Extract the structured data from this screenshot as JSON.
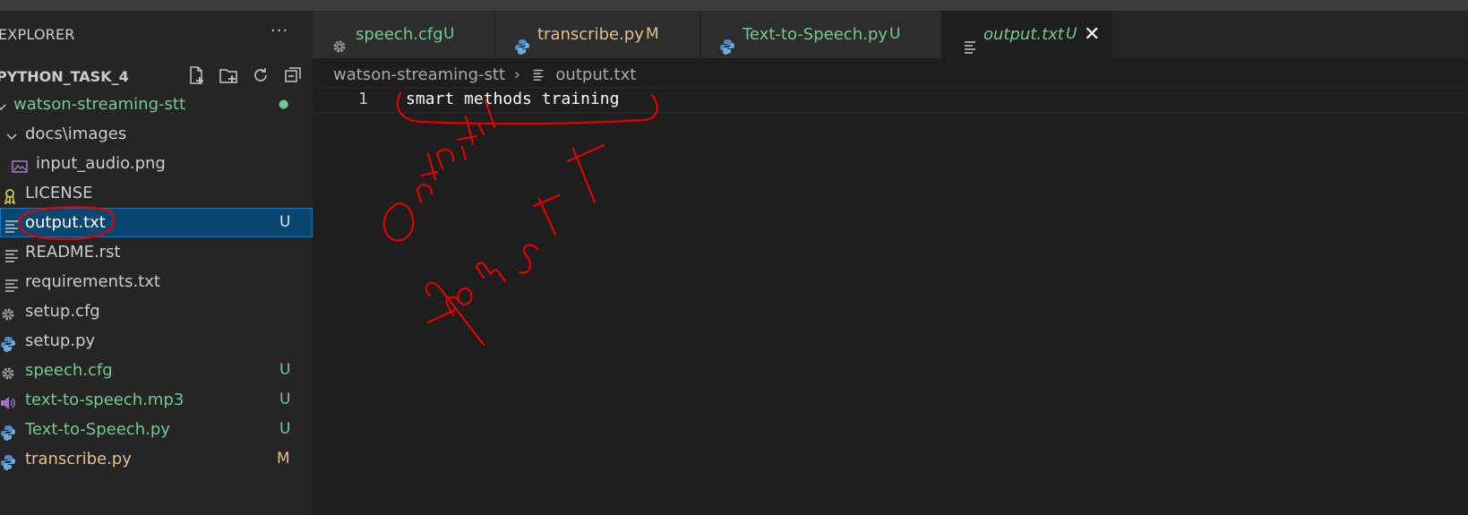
{
  "sidebar": {
    "title": "EXPLORER",
    "more_label": "···",
    "project": "PYTHON_TASK_4",
    "items": [
      {
        "label": "watson-streaming-stt",
        "badge": "●",
        "icon": "chevron-down-icon"
      },
      {
        "label": "docs\\images",
        "badge": "",
        "icon": "chevron-down-icon"
      },
      {
        "label": "input_audio.png",
        "badge": "",
        "icon": "image-icon"
      },
      {
        "label": "LICENSE",
        "badge": "",
        "icon": "license-icon"
      },
      {
        "label": "output.txt",
        "badge": "U",
        "icon": "text-file-icon"
      },
      {
        "label": "README.rst",
        "badge": "",
        "icon": "text-file-icon"
      },
      {
        "label": "requirements.txt",
        "badge": "",
        "icon": "text-file-icon"
      },
      {
        "label": "setup.cfg",
        "badge": "",
        "icon": "gear-icon"
      },
      {
        "label": "setup.py",
        "badge": "",
        "icon": "python-icon"
      },
      {
        "label": "speech.cfg",
        "badge": "U",
        "icon": "gear-icon"
      },
      {
        "label": "text-to-speech.mp3",
        "badge": "U",
        "icon": "audio-icon"
      },
      {
        "label": "Text-to-Speech.py",
        "badge": "U",
        "icon": "python-icon"
      },
      {
        "label": "transcribe.py",
        "badge": "M",
        "icon": "python-icon"
      }
    ]
  },
  "tabs": [
    {
      "label": "speech.cfg",
      "badge": "U",
      "icon": "gear-icon"
    },
    {
      "label": "transcribe.py",
      "badge": "M",
      "icon": "python-icon"
    },
    {
      "label": "Text-to-Speech.py",
      "badge": "U",
      "icon": "python-icon"
    },
    {
      "label": "output.txt",
      "badge": "U",
      "icon": "text-file-icon",
      "close": "✕"
    }
  ],
  "breadcrumb": {
    "folder": "watson-streaming-stt",
    "separator": "›",
    "file": "output.txt"
  },
  "editor": {
    "line_number": "1",
    "line_text": "smart methods training"
  },
  "annotation": {
    "word1": "Output",
    "word2": "from STT",
    "color": "#e00000"
  },
  "colors": {
    "untracked": "#73c991",
    "modified": "#e2c08d",
    "selection": "#094771"
  }
}
